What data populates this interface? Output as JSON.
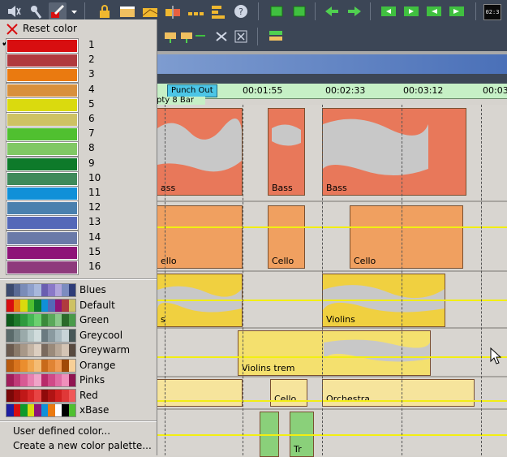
{
  "toolbar": {
    "counter_text": "02:3"
  },
  "ruler": {
    "punch_label": "Punch Out",
    "times": [
      "00:01:55",
      "00:02:33",
      "00:03:12",
      "00:03"
    ],
    "track_label": "pty 8 Bar"
  },
  "clips": {
    "bass": [
      "ass",
      "Bass",
      "Bass"
    ],
    "cello": [
      "ello",
      "Cello",
      "Cello"
    ],
    "violins": [
      "s",
      "Violins"
    ],
    "violins_trem": "Violins trem",
    "orch": [
      "Cello",
      "Orchestra"
    ],
    "tr": "Tr"
  },
  "menu": {
    "reset_label": "Reset color",
    "colors": [
      {
        "num": "1",
        "hex": "#d80e10"
      },
      {
        "num": "2",
        "hex": "#b03a3e"
      },
      {
        "num": "3",
        "hex": "#ea7a10"
      },
      {
        "num": "4",
        "hex": "#d8903c"
      },
      {
        "num": "5",
        "hex": "#dada0e"
      },
      {
        "num": "6",
        "hex": "#cec264"
      },
      {
        "num": "7",
        "hex": "#50c030"
      },
      {
        "num": "8",
        "hex": "#80c864"
      },
      {
        "num": "9",
        "hex": "#0e7a2a"
      },
      {
        "num": "10",
        "hex": "#3e8a5a"
      },
      {
        "num": "11",
        "hex": "#1090d8"
      },
      {
        "num": "12",
        "hex": "#4a80ae"
      },
      {
        "num": "13",
        "hex": "#5468b8"
      },
      {
        "num": "14",
        "hex": "#6a7aa8"
      },
      {
        "num": "15",
        "hex": "#8e1478"
      },
      {
        "num": "16",
        "hex": "#8e3a7c"
      }
    ],
    "palettes": [
      {
        "name": "Blues",
        "colors": [
          "#3c4a6e",
          "#5a6a94",
          "#7a8cb8",
          "#8ea0cc",
          "#a8b8dc",
          "#6a5eb0",
          "#8a78c8",
          "#b0a4dc",
          "#7c8cc0",
          "#2e3c78"
        ]
      },
      {
        "name": "Default",
        "colors": [
          "#d80e10",
          "#ea7a10",
          "#dada0e",
          "#50c030",
          "#0e7a2a",
          "#1090d8",
          "#5468b8",
          "#8e1478",
          "#b03a3e",
          "#cec264"
        ]
      },
      {
        "name": "Green",
        "colors": [
          "#0e5a1a",
          "#1e7a2a",
          "#2e9a3e",
          "#46b856",
          "#6cd070",
          "#3a8a3a",
          "#5aa85a",
          "#8ac88a",
          "#2a6a2a",
          "#4a9a4a"
        ]
      },
      {
        "name": "Greycool",
        "colors": [
          "#5a6a6a",
          "#7a8a8a",
          "#9aaaaa",
          "#b8c8c8",
          "#d0dcdc",
          "#6a7a80",
          "#8a9aa0",
          "#aabac0",
          "#c8d4d8",
          "#485858"
        ]
      },
      {
        "name": "Greywarm",
        "colors": [
          "#6a5a4e",
          "#8a7a6a",
          "#a89888",
          "#c4b4a4",
          "#dccec0",
          "#7a6a5e",
          "#9a8a7a",
          "#b8a898",
          "#d4c4b4",
          "#584a40"
        ]
      },
      {
        "name": "Orange",
        "colors": [
          "#b85a0e",
          "#d8741e",
          "#ea8e2e",
          "#f0a64e",
          "#f4bc74",
          "#c86a1a",
          "#e08434",
          "#f09c54",
          "#a04a08",
          "#f8d098"
        ]
      },
      {
        "name": "Pinks",
        "colors": [
          "#a01e5a",
          "#c03a78",
          "#d85a94",
          "#e880b0",
          "#f0a4c8",
          "#b82a6a",
          "#d04a88",
          "#e06ca4",
          "#f090bc",
          "#901450"
        ]
      },
      {
        "name": "Red",
        "colors": [
          "#7a0808",
          "#a00e0e",
          "#c01818",
          "#d82828",
          "#e84444",
          "#900a0a",
          "#b01414",
          "#d02020",
          "#e03838",
          "#f05858"
        ]
      },
      {
        "name": "xBase",
        "colors": [
          "#1e1ea0",
          "#d80e10",
          "#0e9a2a",
          "#dada0e",
          "#8e1478",
          "#1090d8",
          "#ea7a10",
          "#ffffff",
          "#000000",
          "#50c030"
        ]
      }
    ],
    "user_defined": "User defined color...",
    "create_palette": "Create a new color palette..."
  }
}
